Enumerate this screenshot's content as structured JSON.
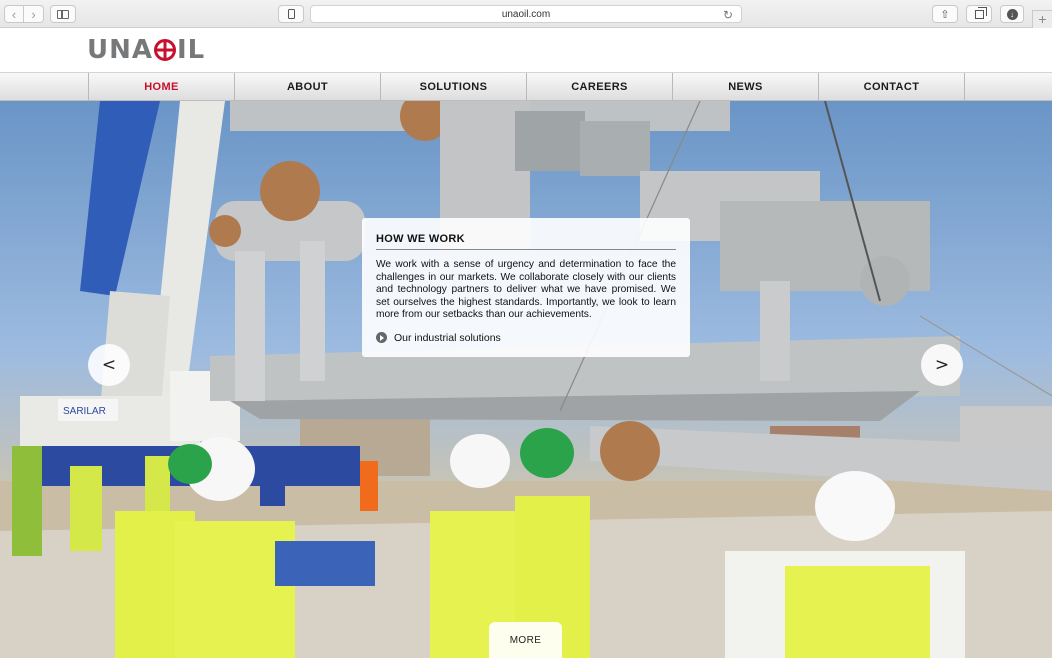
{
  "browser": {
    "url": "unaoil.com",
    "back_icon": "chevron-left-icon",
    "forward_icon": "chevron-right-icon",
    "sidebar_icon": "sidebar-icon",
    "reader_icon": "phone-icon",
    "reload_icon": "reload-icon",
    "share_icon": "share-icon",
    "tabs_icon": "tabs-icon",
    "download_icon": "download-icon",
    "new_tab_icon": "plus-icon"
  },
  "header": {
    "logo_left": "UNA",
    "logo_right": "IL",
    "brand_color": "#c8102e"
  },
  "nav": {
    "items": [
      {
        "label": "HOME",
        "active": true
      },
      {
        "label": "ABOUT",
        "active": false
      },
      {
        "label": "SOLUTIONS",
        "active": false
      },
      {
        "label": "CAREERS",
        "active": false
      },
      {
        "label": "NEWS",
        "active": false
      },
      {
        "label": "CONTACT",
        "active": false
      }
    ]
  },
  "hero": {
    "panel": {
      "title": "HOW WE WORK",
      "body": "We work with a sense of urgency and determination to face the challenges in our markets. We collaborate closely with our clients and technology partners to deliver what we have promised. We set ourselves the highest standards. Importantly, we look to learn more from our setbacks than our achievements.",
      "link": "Our industrial solutions"
    },
    "prev_label": "<",
    "next_label": ">",
    "more_label": "MORE",
    "crane_label": "SARILAR"
  }
}
